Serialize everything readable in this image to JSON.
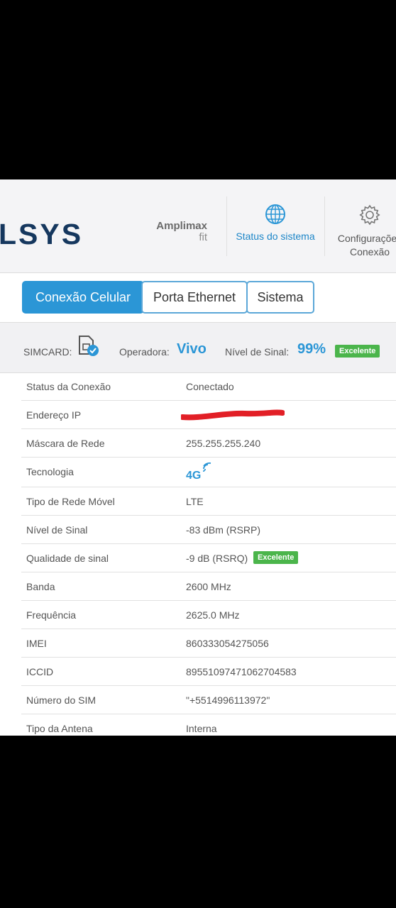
{
  "brand": {
    "logo_text": "LSYS",
    "product_line1": "Amplimax",
    "product_line2": "fit"
  },
  "nav": {
    "status_label": "Status do sistema",
    "config_line1": "Configurações",
    "config_line2": "Conexão"
  },
  "tabs": [
    {
      "label": "Conexão Celular",
      "active": true
    },
    {
      "label": "Porta Ethernet",
      "active": false
    },
    {
      "label": "Sistema",
      "active": false
    }
  ],
  "simbar": {
    "simcard_label": "SIMCARD:",
    "operator_label": "Operadora:",
    "operator_value": "Vivo",
    "signal_label": "Nível de Sinal:",
    "signal_value": "99%",
    "signal_badge": "Excelente"
  },
  "rows": [
    {
      "key": "Status da Conexão",
      "value": "Conectado"
    },
    {
      "key": "Endereço IP",
      "value": ""
    },
    {
      "key": "Máscara de Rede",
      "value": "255.255.255.240"
    },
    {
      "key": "Tecnologia",
      "value": "4G"
    },
    {
      "key": "Tipo de Rede Móvel",
      "value": "LTE"
    },
    {
      "key": "Nível de Sinal",
      "value": "-83 dBm (RSRP)"
    },
    {
      "key": "Qualidade de sinal",
      "value": "-9 dB (RSRQ)",
      "badge": "Excelente"
    },
    {
      "key": "Banda",
      "value": "2600 MHz"
    },
    {
      "key": "Frequência",
      "value": "2625.0 MHz"
    },
    {
      "key": "IMEI",
      "value": "860333054275056"
    },
    {
      "key": "ICCID",
      "value": "89551097471062704583"
    },
    {
      "key": "Número do SIM",
      "value": "\"+5514996113972\""
    },
    {
      "key": "Tipo da Antena",
      "value": "Interna"
    }
  ],
  "colors": {
    "accent": "#2b96d6",
    "brand": "#15375e",
    "badge": "#4bb54b"
  }
}
